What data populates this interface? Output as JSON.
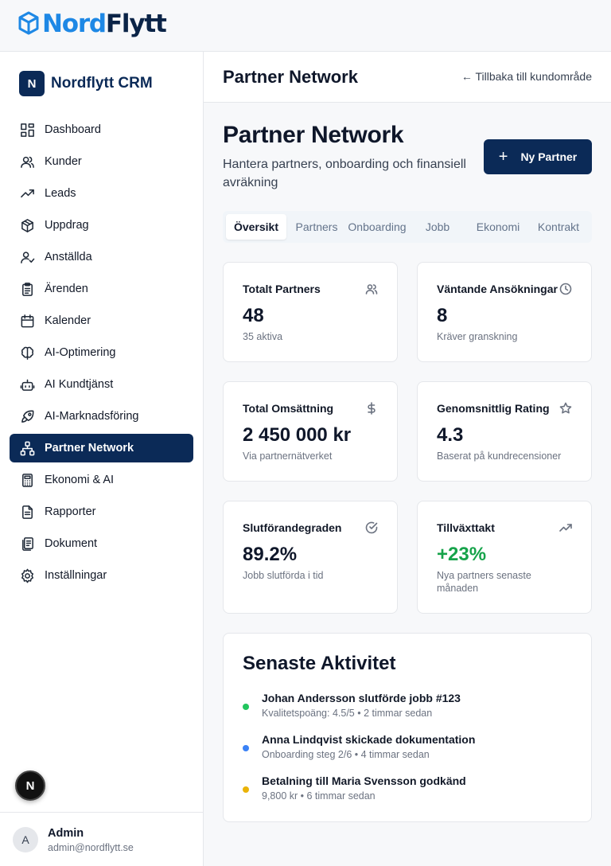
{
  "logo": {
    "part1": "Nord",
    "part2": "Flytt"
  },
  "sidebar": {
    "brand_badge": "N",
    "brand_name": "Nordflytt CRM",
    "items": [
      {
        "label": "Dashboard",
        "icon": "dashboard-icon"
      },
      {
        "label": "Kunder",
        "icon": "users-icon"
      },
      {
        "label": "Leads",
        "icon": "trending-up-icon"
      },
      {
        "label": "Uppdrag",
        "icon": "package-icon"
      },
      {
        "label": "Anställda",
        "icon": "user-check-icon"
      },
      {
        "label": "Ärenden",
        "icon": "clipboard-icon"
      },
      {
        "label": "Kalender",
        "icon": "calendar-icon"
      },
      {
        "label": "AI-Optimering",
        "icon": "brain-icon"
      },
      {
        "label": "AI Kundtjänst",
        "icon": "bot-icon"
      },
      {
        "label": "AI-Marknadsföring",
        "icon": "rocket-icon"
      },
      {
        "label": "Partner Network",
        "icon": "network-icon",
        "active": true
      },
      {
        "label": "Ekonomi & AI",
        "icon": "calculator-icon"
      },
      {
        "label": "Rapporter",
        "icon": "file-text-icon"
      },
      {
        "label": "Dokument",
        "icon": "files-icon"
      },
      {
        "label": "Inställningar",
        "icon": "settings-icon"
      }
    ],
    "floating_badge": "N",
    "user": {
      "avatar": "A",
      "name": "Admin",
      "email": "admin@nordflytt.se"
    }
  },
  "header": {
    "title": "Partner Network",
    "back_label": "← Tillbaka till kundområde"
  },
  "main": {
    "title": "Partner Network",
    "subtitle": "Hantera partners, onboarding och finansiell avräkning",
    "new_button": {
      "plus": "+",
      "label": "Ny Partner"
    },
    "tabs": [
      "Översikt",
      "Partners",
      "Onboarding",
      "Jobb",
      "Ekonomi",
      "Kontrakt"
    ],
    "active_tab": 0
  },
  "stats": [
    {
      "title": "Totalt Partners",
      "value": "48",
      "note": "35 aktiva",
      "icon": "users-icon"
    },
    {
      "title": "Väntande Ansökningar",
      "value": "8",
      "note": "Kräver granskning",
      "icon": "clock-icon"
    },
    {
      "title": "Total Omsättning",
      "value": "2 450 000 kr",
      "note": "Via partnernätverket",
      "icon": "dollar-icon"
    },
    {
      "title": "Genomsnittlig Rating",
      "value": "4.3",
      "note": "Baserat på kundrecensioner",
      "icon": "star-icon"
    },
    {
      "title": "Slutförandegraden",
      "value": "89.2%",
      "note": "Jobb slutförda i tid",
      "icon": "check-circle-icon"
    },
    {
      "title": "Tillväxttakt",
      "value": "+23%",
      "note": "Nya partners senaste månaden",
      "icon": "trending-up-icon",
      "value_color": "#16a34a"
    }
  ],
  "activity": {
    "title": "Senaste Aktivitet",
    "items": [
      {
        "main": "Johan Andersson slutförde jobb #123",
        "sub": "Kvalitetspoäng: 4.5/5 • 2 timmar sedan",
        "color": "#22c55e"
      },
      {
        "main": "Anna Lindqvist skickade dokumentation",
        "sub": "Onboarding steg 2/6 • 4 timmar sedan",
        "color": "#3b82f6"
      },
      {
        "main": "Betalning till Maria Svensson godkänd",
        "sub": "9,800 kr • 6 timmar sedan",
        "color": "#eab308"
      }
    ]
  }
}
